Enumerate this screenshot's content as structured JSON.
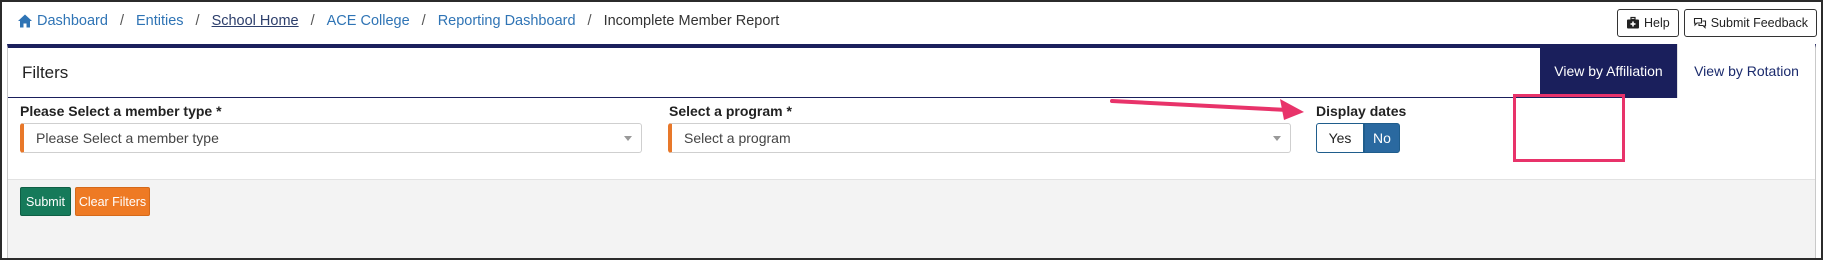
{
  "breadcrumb": {
    "items": [
      {
        "label": "Dashboard"
      },
      {
        "label": "Entities"
      },
      {
        "label": "School Home"
      },
      {
        "label": "ACE College"
      },
      {
        "label": "Reporting Dashboard"
      }
    ],
    "current": "Incomplete Member Report",
    "separator": "/"
  },
  "top_actions": {
    "help_label": "Help",
    "feedback_label": "Submit Feedback"
  },
  "panel": {
    "title": "Filters",
    "tabs": [
      {
        "label": "View by Affiliation",
        "active": true
      },
      {
        "label": "View by Rotation",
        "active": false
      }
    ]
  },
  "filters": {
    "member_type": {
      "label": "Please Select a member type *",
      "placeholder": "Please Select a member type"
    },
    "program": {
      "label": "Select a program *",
      "placeholder": "Select a program"
    },
    "display_dates": {
      "label": "Display dates",
      "yes_label": "Yes",
      "no_label": "No",
      "selected": "No"
    }
  },
  "actions": {
    "submit_label": "Submit",
    "clear_label": "Clear Filters"
  },
  "colors": {
    "navy": "#1a1f5c",
    "link_blue": "#2f74b5",
    "required_orange": "#e8782a",
    "submit_green": "#167a5a",
    "clear_orange": "#ee7a24",
    "toggle_blue": "#2a69a0",
    "annotation_pink": "#e8336a"
  }
}
